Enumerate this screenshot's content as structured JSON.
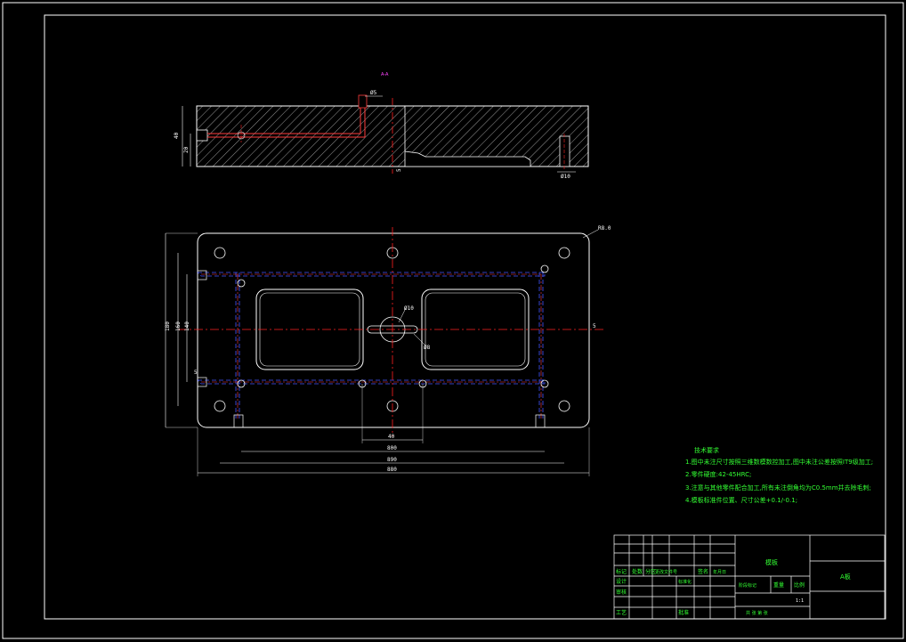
{
  "colors": {
    "background": "#000000",
    "outline": "#ffffff",
    "cooling_channel": "#ff3b3b",
    "hidden_line": "#4455ff",
    "center_line": "#ff2020",
    "notes": "#33ff33",
    "title_block_lines": "#ffffff",
    "title_text": "#ff44ff"
  },
  "section_view": {
    "label_top": "A-A",
    "dim_depth": "Ø5",
    "dim_height_total": "40",
    "dim_height_inner": "20",
    "dim_small_step": "5",
    "dim_pin": "Ø10"
  },
  "plan_view": {
    "dim_radius": "R8.0",
    "dim_width_outer": "180",
    "dim_width_mid": "160",
    "dim_width_inner": "140",
    "dim_small": "5",
    "dim_center": "Ø10",
    "dim_gate": "Ø8",
    "dim_bottom_inner": "40",
    "dim_bottom_mid": "800",
    "dim_bottom_outer": "890",
    "dim_bottom_total": "880"
  },
  "notes": {
    "heading": "技术要求",
    "items": [
      "1.图中未注尺寸按照三维数模数控加工,图中未注公差按照IT9级加工;",
      "2.零件硬度:42-45HRC;",
      "3.注意与其他零件配合加工,所有未注倒角均为C0.5mm并去除毛刺;",
      "4.模板标准件位置、尺寸公差+0.1/-0.1;"
    ]
  },
  "title_block": {
    "drawing_name": "A板",
    "part_name": "模板",
    "scale": "1:1",
    "row_labels": [
      "标记",
      "处数",
      "分区",
      "更改文件号",
      "签名",
      "年月日"
    ],
    "design_label": "设计",
    "check_label": "审核",
    "process_label": "工艺",
    "standard_label": "标准化",
    "approve_label": "批准",
    "stage_label": "阶段标记",
    "weight_label": "重量",
    "ratio_label": "比例",
    "sheet_label": "共 张 第 张"
  }
}
